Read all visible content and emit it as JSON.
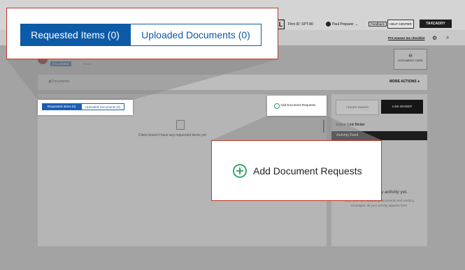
{
  "header": {
    "firm_label": "Firm ID: SPT-80",
    "user_name": "Paul Preparer",
    "feedback": "Feedback",
    "help_center": "HELP CENTER",
    "product_button": "TAXCADDY",
    "pre_season_link": "Pre-season tax checklist",
    "logo_letter": "L"
  },
  "client": {
    "following_badge": "FOLLOWING",
    "type_label": "Official",
    "corner_label": "DOCUMENT CARD"
  },
  "documents_bar": {
    "label": "Documents",
    "more_actions": "MORE ACTIONS"
  },
  "tabs": {
    "requested": "Requested Items (0)",
    "uploaded": "Uploaded Documents (0)"
  },
  "add_request": {
    "label": "Add Document Requests"
  },
  "main": {
    "empty_message": "Client doesn't have any requested items yet."
  },
  "binder": {
    "create": "CREATE BINDER",
    "link": "LINK BINDER",
    "status": "Status: Link Binder"
  },
  "activity": {
    "header": "Activity Feed",
    "empty_title": "any activity yet.",
    "empty_body": "Once you start uploading documents and sending messages, all your activity appears here."
  },
  "colors": {
    "primary_blue": "#0d5aa7",
    "callout_border": "#c0392b",
    "add_green": "#2a9d5b"
  }
}
